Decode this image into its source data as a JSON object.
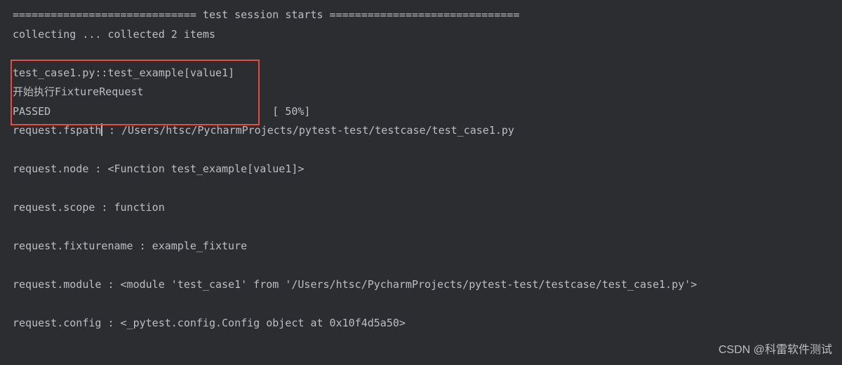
{
  "lines": {
    "l1": "============================= test session starts ==============================",
    "l2": "collecting ... collected 2 items",
    "l3": "",
    "l4": "test_case1.py::test_example[value1] ",
    "l5": "开始执行FixtureRequest",
    "l6": "PASSED                                   [ 50%]",
    "l7a": "request.fspath",
    "l7b": " : /Users/htsc/PycharmProjects/pytest-test/testcase/test_case1.py",
    "l8": "",
    "l9": "request.node : <Function test_example[value1]>",
    "l10": "",
    "l11": "request.scope : function",
    "l12": "",
    "l13": "request.fixturename : example_fixture",
    "l14": "",
    "l15": "request.module : <module 'test_case1' from '/Users/htsc/PycharmProjects/pytest-test/testcase/test_case1.py'>",
    "l16": "",
    "l17": "request.config : <_pytest.config.Config object at 0x10f4d5a50>"
  },
  "watermark": "CSDN @科雷软件测试"
}
